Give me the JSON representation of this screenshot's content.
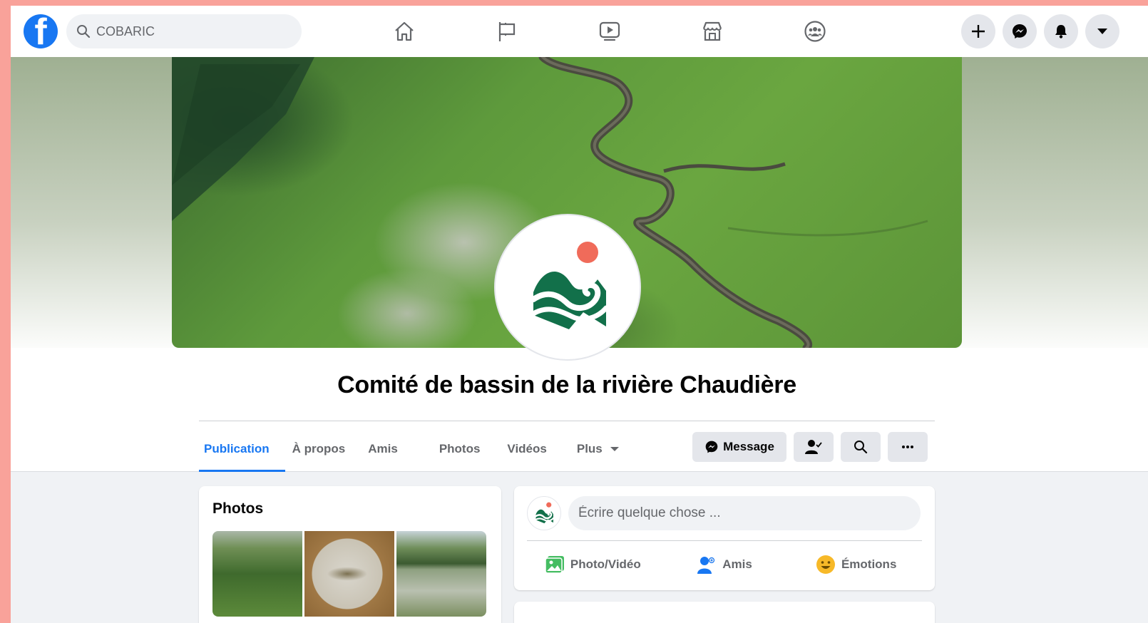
{
  "topbar": {
    "logo_letter": "f",
    "search": {
      "value": "COBARIC",
      "placeholder": ""
    },
    "nav": [
      {
        "name": "home-icon"
      },
      {
        "name": "pages-flag-icon"
      },
      {
        "name": "watch-video-icon"
      },
      {
        "name": "marketplace-icon"
      },
      {
        "name": "groups-icon"
      }
    ],
    "right": [
      {
        "name": "create-plus-icon"
      },
      {
        "name": "messenger-icon"
      },
      {
        "name": "notifications-bell-icon"
      },
      {
        "name": "account-caret-icon"
      }
    ]
  },
  "page": {
    "title": "Comité de bassin de la rivière Chaudière"
  },
  "tabs": [
    {
      "label": "Publication",
      "active": true
    },
    {
      "label": "À propos",
      "active": false
    },
    {
      "label": "Amis",
      "active": false
    },
    {
      "label": "Photos",
      "active": false
    },
    {
      "label": "Vidéos",
      "active": false
    },
    {
      "label": "Plus",
      "active": false
    }
  ],
  "actions": {
    "message_label": "Message"
  },
  "photos_card": {
    "title": "Photos"
  },
  "composer": {
    "placeholder": "Écrire quelque chose ...",
    "photo_video": "Photo/Vidéo",
    "friends": "Amis",
    "emotions": "Émotions"
  },
  "colors": {
    "brand_blue": "#1877f2",
    "logo_green": "#12704a",
    "logo_sun": "#f06b5a",
    "outer_frame": "#f9a29a"
  }
}
